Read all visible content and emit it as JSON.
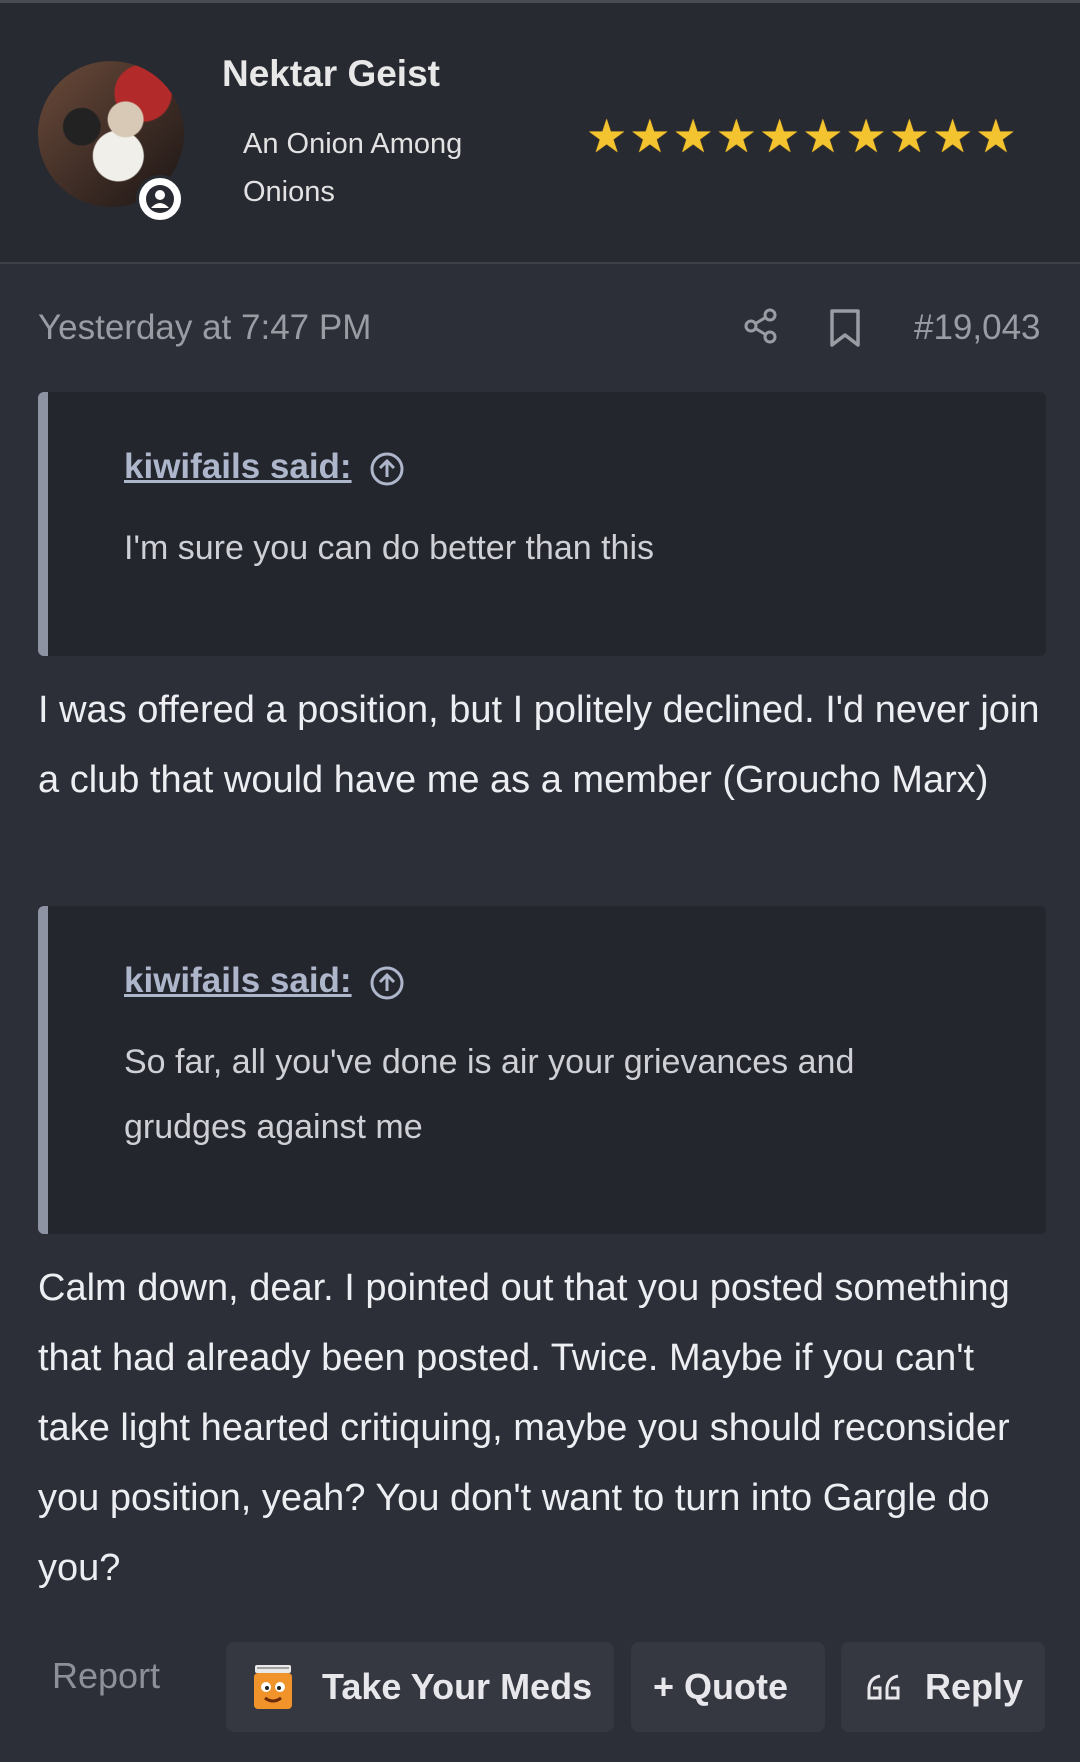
{
  "user": {
    "name": "Nektar Geist",
    "title": "An Onion Among Onions",
    "stars": 10
  },
  "post_meta": {
    "date": "Yesterday at 7:47 PM",
    "number": "#19,043"
  },
  "quotes": [
    {
      "author": "kiwifails said:",
      "text": "I'm sure you can do better than this"
    },
    {
      "author": "kiwifails said:",
      "text": "So far, all you've done is air your grievances and grudges against me"
    }
  ],
  "body": {
    "paragraph1": "I was offered a position, but I politely declined. I'd never join a club that would have me as a member (Groucho Marx)",
    "paragraph2": "Calm down, dear. I pointed out that you posted something that had already been posted. Twice. Maybe if you can't take light hearted critiquing, maybe you should reconsider you position, yeah? You don't want to turn into Gargle do you?"
  },
  "actions": {
    "report": "Report",
    "reaction": "Take Your Meds",
    "quote": "+ Quote",
    "reply": "Reply"
  },
  "colors": {
    "background": "#2d2f38",
    "star": "#f4c430",
    "quote_border": "#8d93a3",
    "link": "#aeb6cc"
  },
  "icons": [
    "share-icon",
    "bookmark-icon",
    "arrow-up-circle-icon",
    "quote-marks-icon",
    "pill-bottle-icon",
    "user-badge-icon"
  ]
}
